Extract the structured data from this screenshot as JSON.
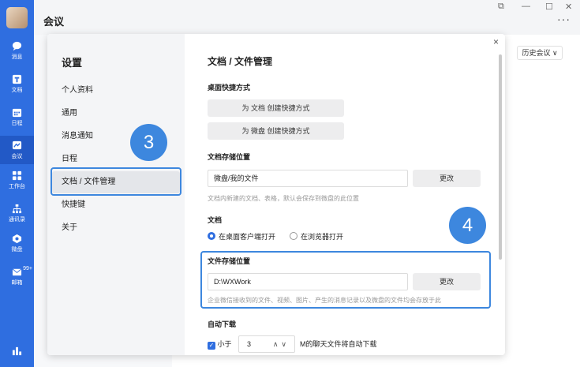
{
  "app": {
    "title": "会议"
  },
  "rail": [
    {
      "label": "消息"
    },
    {
      "label": "文档"
    },
    {
      "label": "日程"
    },
    {
      "label": "会议"
    },
    {
      "label": "工作台"
    },
    {
      "label": "通讯录"
    },
    {
      "label": "微盘"
    },
    {
      "label": "邮箱",
      "badge": "99+"
    }
  ],
  "window": {
    "restore": "⧉",
    "minimize": "—",
    "maximize": "☐",
    "close": "✕",
    "more": "···"
  },
  "history_button": "历史会议 ∨",
  "dialog": {
    "sidebar_title": "设置",
    "nav": [
      "个人资料",
      "通用",
      "消息通知",
      "日程",
      "文档 / 文件管理",
      "快捷键",
      "关于"
    ],
    "selected_index": 4,
    "close": "×",
    "content": {
      "title": "文档 / 文件管理",
      "shortcut": {
        "label": "桌面快捷方式",
        "btn_doc": "为 文档 创建快捷方式",
        "btn_disk": "为 微盘 创建快捷方式"
      },
      "doc_storage": {
        "label": "文档存储位置",
        "value": "微盘/我的文件",
        "change": "更改",
        "hint": "文档内新建的文档、表格，默认会保存到微盘的此位置"
      },
      "doc_open": {
        "label": "文档",
        "option1": "在桌面客户端打开",
        "option2": "在浏览器打开",
        "selected": "option1"
      },
      "file_storage": {
        "label": "文件存储位置",
        "value": "D:\\WXWork",
        "change": "更改",
        "hint": "企业微信接收到的文件、视频、图片、产生的消息记录以及微盘的文件均会存放于此"
      },
      "auto_download": {
        "label": "自动下载",
        "checked": true,
        "prefix": "小于",
        "value": "3",
        "suffix": "M的聊天文件将自动下载"
      }
    }
  },
  "annotations": {
    "step3": "3",
    "step4": "4",
    "highlight_color": "#3d87de"
  }
}
